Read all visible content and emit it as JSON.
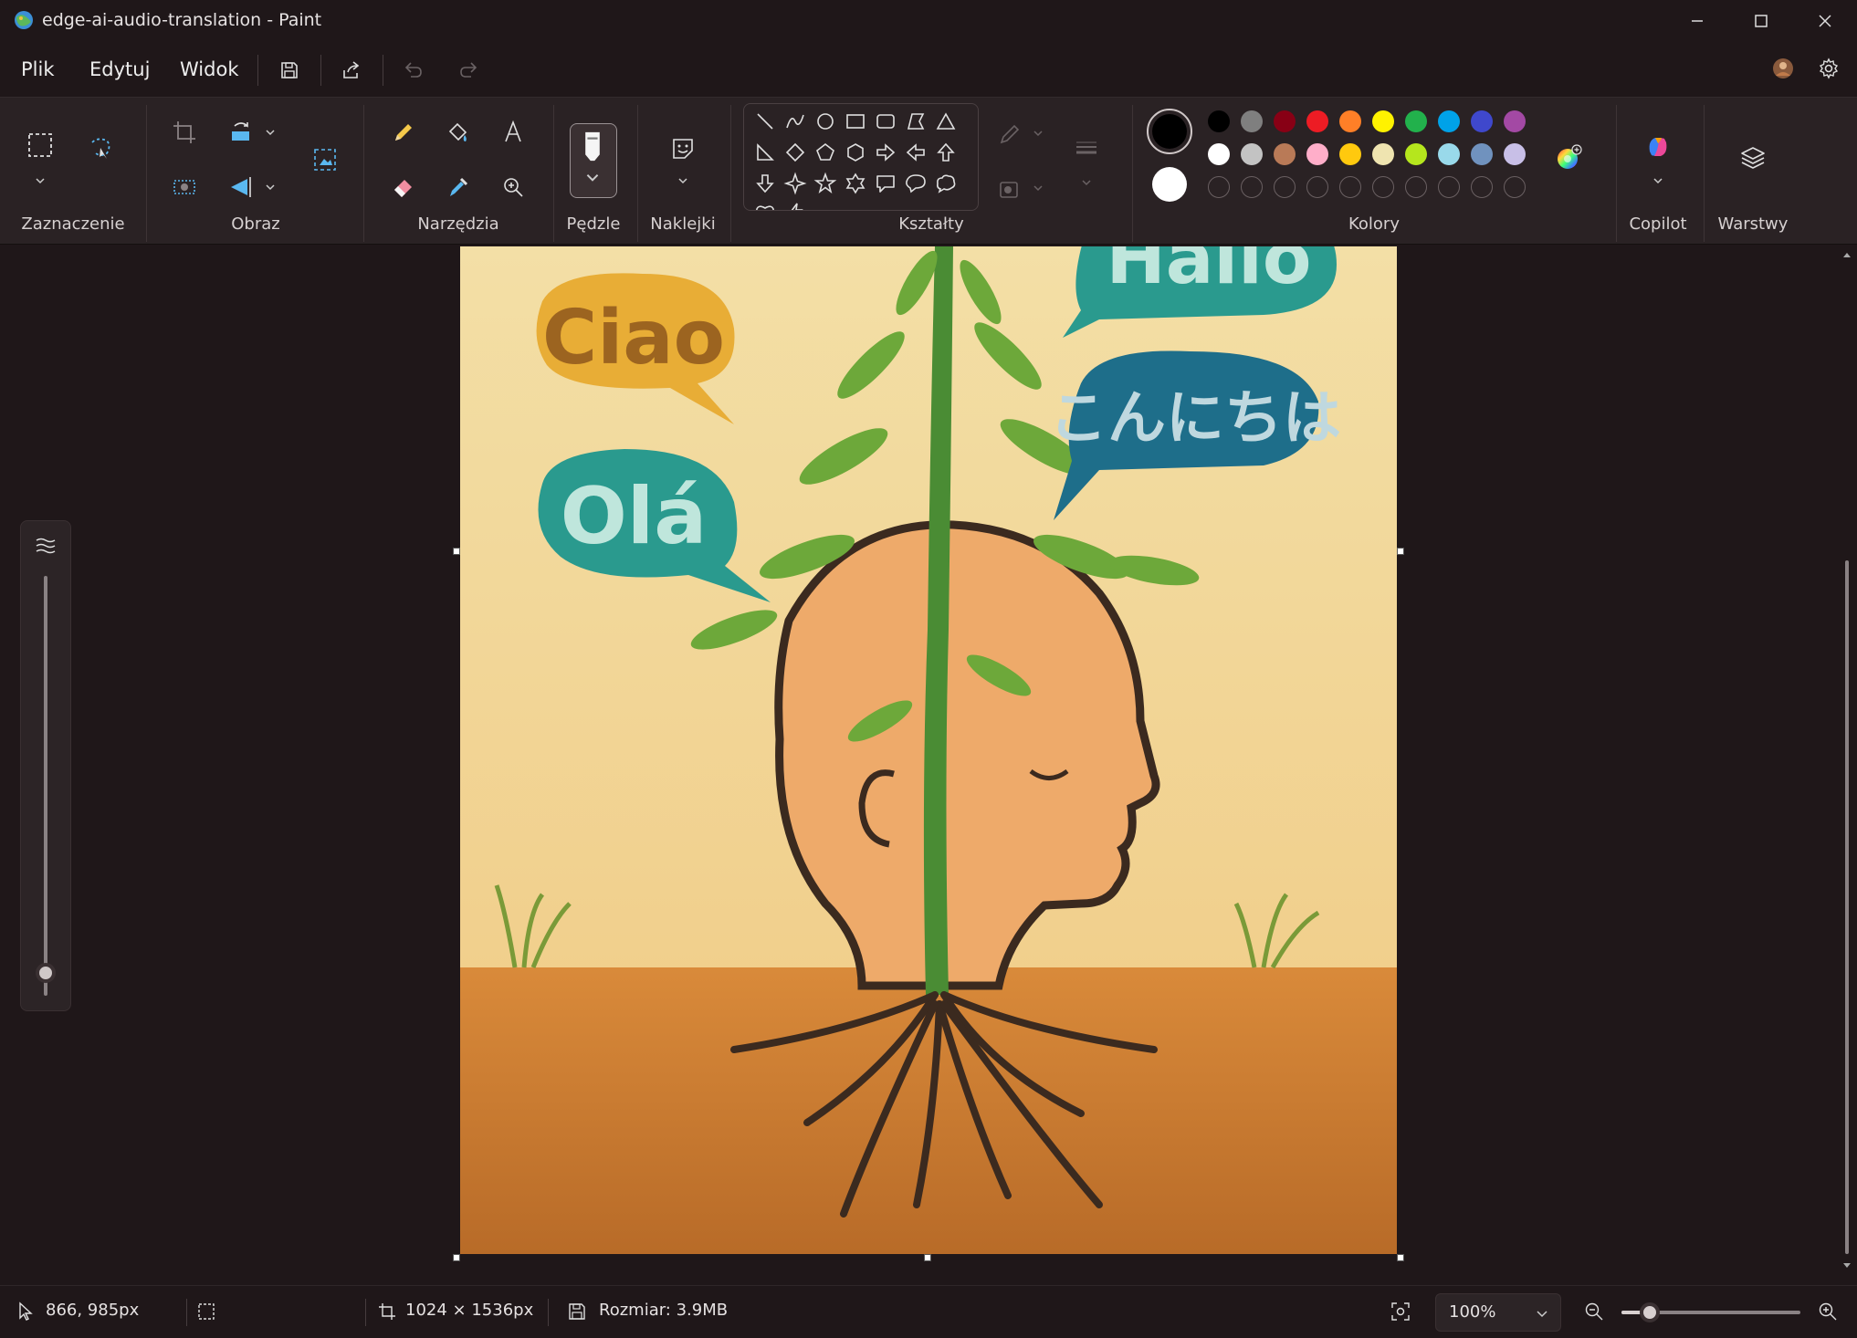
{
  "window": {
    "title": "edge-ai-audio-translation - Paint"
  },
  "menu": {
    "items": [
      "Plik",
      "Edytuj",
      "Widok"
    ]
  },
  "ribbon": {
    "groups": {
      "selection": "Zaznaczenie",
      "image": "Obraz",
      "tools": "Narzędzia",
      "brushes": "Pędzle",
      "stickers": "Naklejki",
      "shapes": "Kształty",
      "colors": "Kolory",
      "copilot": "Copilot",
      "layers": "Warstwy"
    },
    "palette": {
      "row1": [
        "#000000",
        "#7f7f7f",
        "#880015",
        "#ed1c24",
        "#ff7f27",
        "#fff200",
        "#22b14c",
        "#00a2e8",
        "#3f48cc",
        "#a349a4"
      ],
      "row2": [
        "#ffffff",
        "#c3c3c3",
        "#b97a57",
        "#ffaec9",
        "#ffc90e",
        "#efe4b0",
        "#b5e61d",
        "#99d9ea",
        "#7092be",
        "#c8bfe7"
      ],
      "primary": "#000000",
      "secondary": "#ffffff"
    }
  },
  "canvas": {
    "bubbles": {
      "ciao": "Ciao",
      "hallo": "Hallo",
      "japanese": "こんにちは",
      "ola": "Olá"
    }
  },
  "status": {
    "cursor": "866, 985px",
    "dimensions": "1024 × 1536px",
    "size": "Rozmiar: 3.9MB",
    "zoom": "100%",
    "zoom_fraction": 0.16
  }
}
